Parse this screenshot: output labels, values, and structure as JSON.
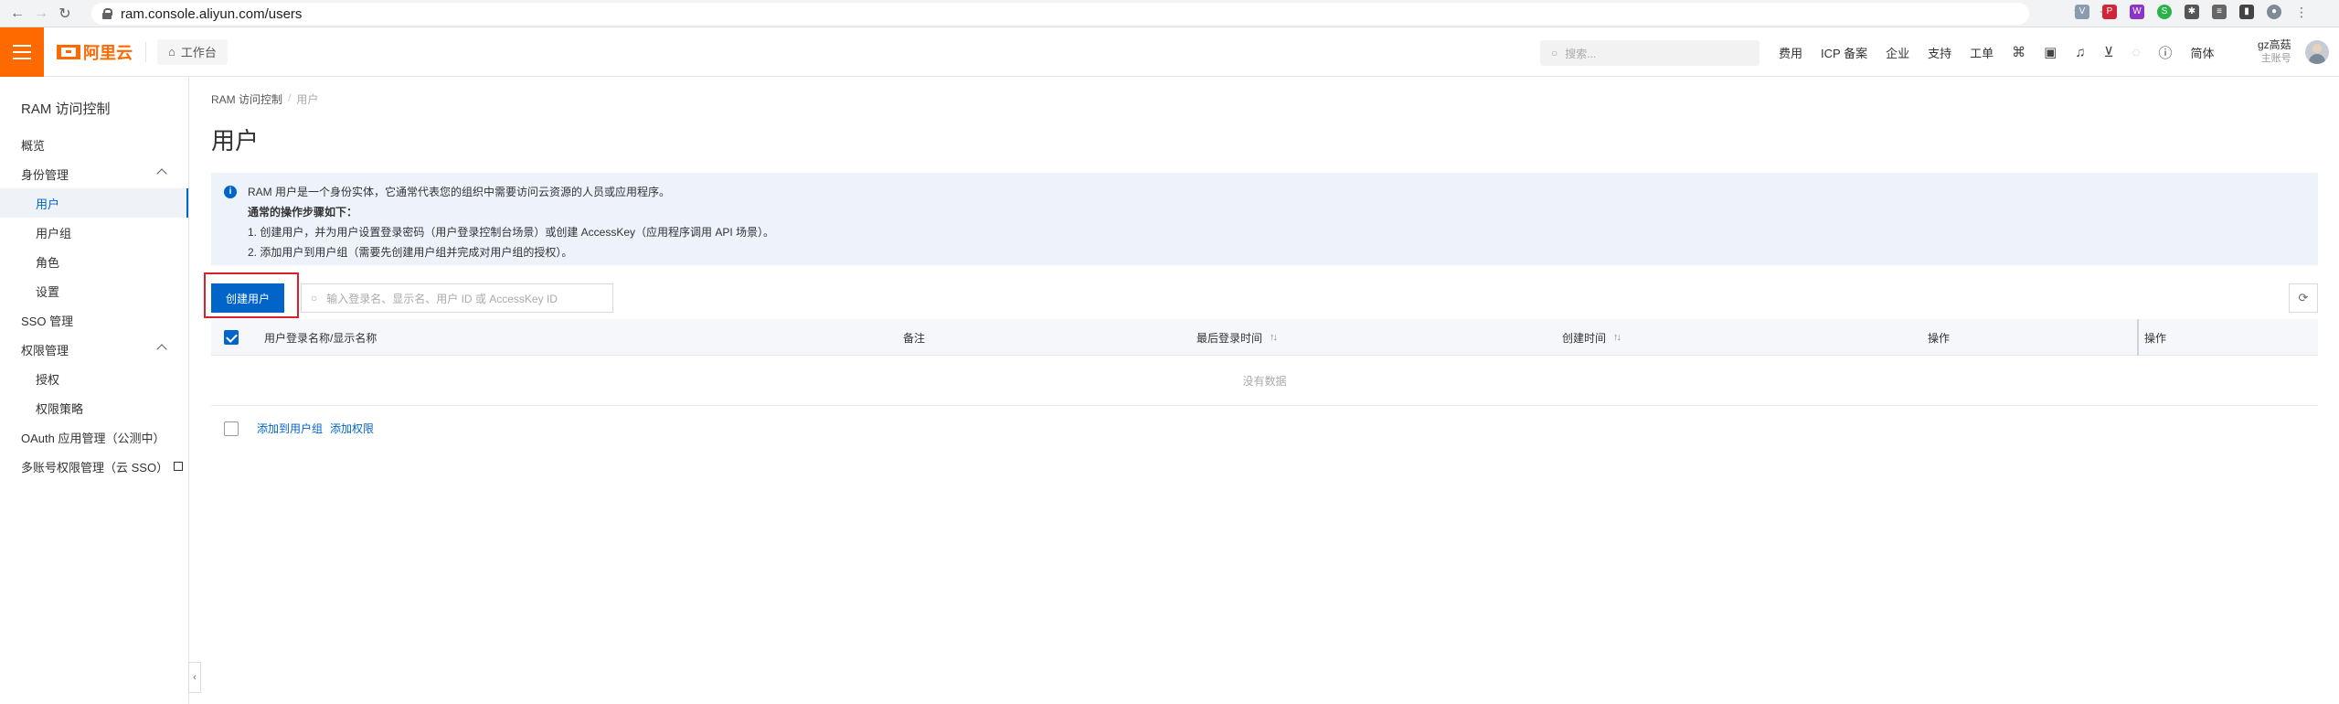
{
  "browser": {
    "url": "ram.console.aliyun.com/users"
  },
  "topbar": {
    "logo_text": "阿里云",
    "workbench_label": "工作台",
    "search_placeholder": "搜索...",
    "links": [
      "费用",
      "ICP 备案",
      "企业",
      "支持",
      "工单"
    ],
    "lang": "简体",
    "user_name": "gz高菇",
    "user_role": "主账号"
  },
  "sidebar": {
    "title": "RAM 访问控制",
    "items": [
      {
        "label": "概览"
      },
      {
        "label": "身份管理"
      },
      {
        "label": "用户"
      },
      {
        "label": "用户组"
      },
      {
        "label": "角色"
      },
      {
        "label": "设置"
      },
      {
        "label": "SSO 管理"
      },
      {
        "label": "权限管理"
      },
      {
        "label": "授权"
      },
      {
        "label": "权限策略"
      },
      {
        "label": "OAuth 应用管理（公测中）"
      },
      {
        "label": "多账号权限管理（云 SSO）"
      }
    ]
  },
  "main": {
    "breadcrumb": [
      "RAM 访问控制",
      "用户"
    ],
    "title": "用户",
    "notice": {
      "line1": "RAM 用户是一个身份实体，它通常代表您的组织中需要访问云资源的人员或应用程序。",
      "line2": "通常的操作步骤如下：",
      "line3": "1. 创建用户，并为用户设置登录密码（用户登录控制台场景）或创建 AccessKey（应用程序调用 API 场景）。",
      "line4": "2. 添加用户到用户组（需要先创建用户组并完成对用户组的授权）。"
    },
    "create_button": "创建用户",
    "search_placeholder": "输入登录名、显示名、用户 ID 或 AccessKey ID",
    "table": {
      "columns": [
        "用户登录名称/显示名称",
        "备注",
        "最后登录时间",
        "创建时间",
        "操作",
        "操作"
      ],
      "empty_text": "没有数据"
    },
    "bottom_actions": [
      "添加到用户组",
      "添加权限"
    ]
  }
}
